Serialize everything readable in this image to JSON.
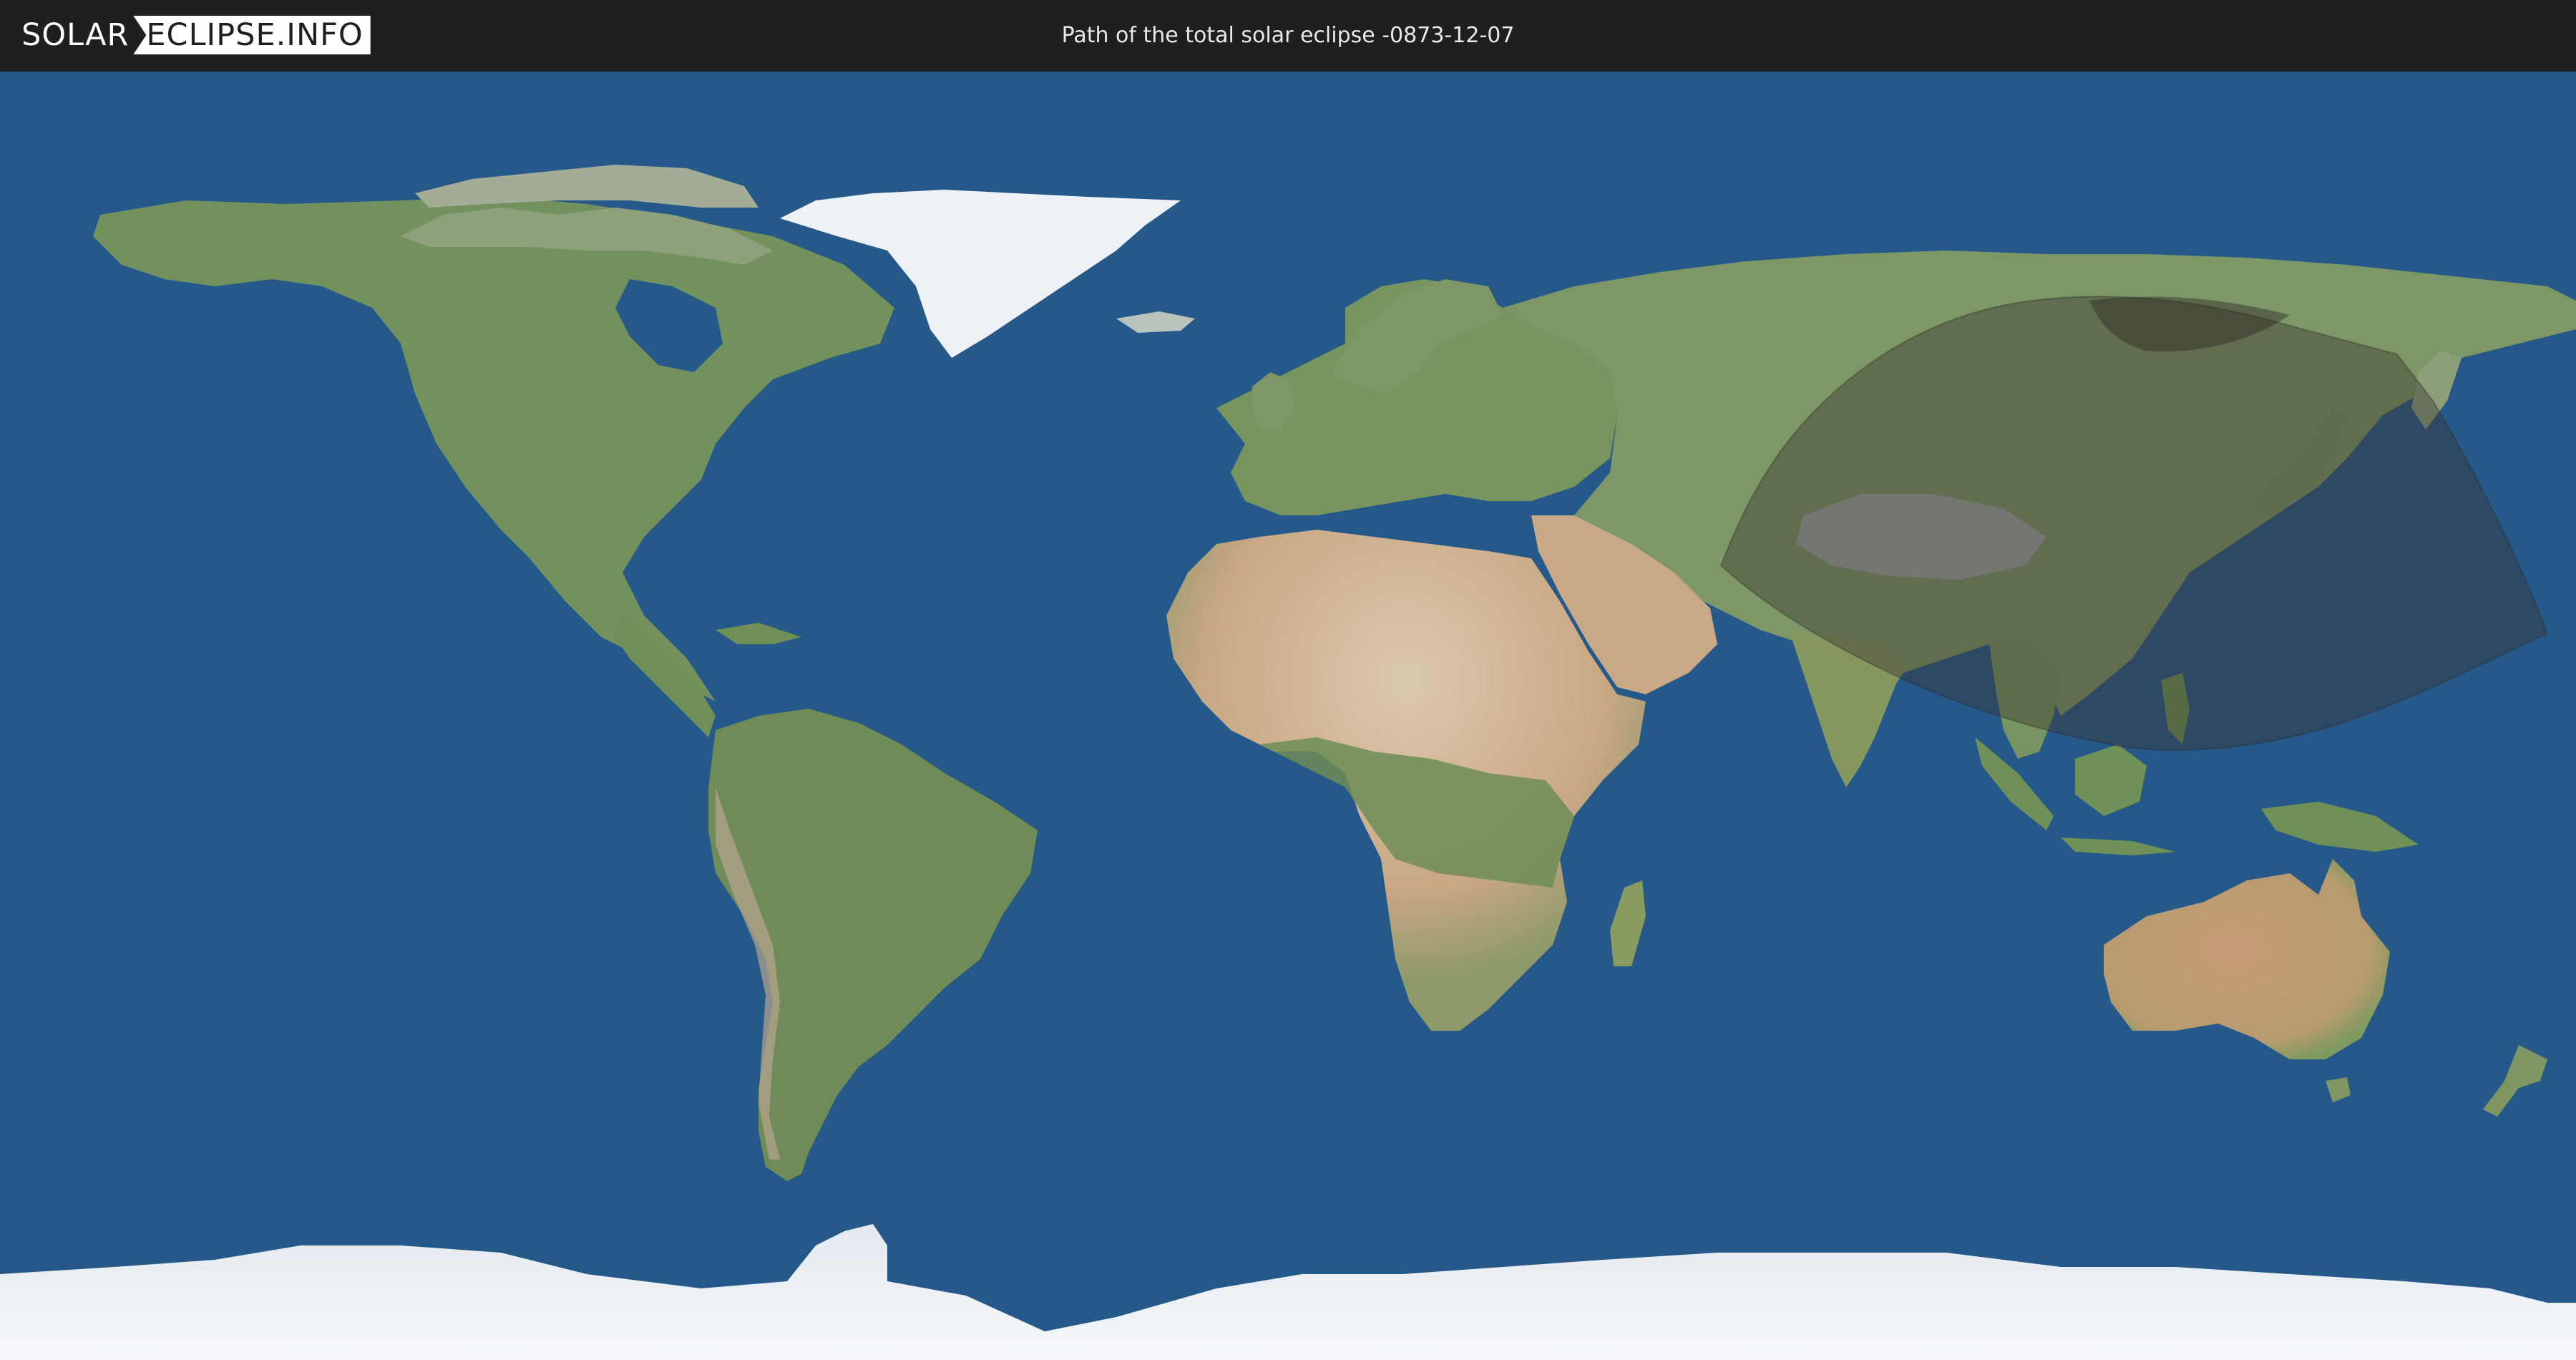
{
  "header": {
    "logo_part1": "SOLAR",
    "logo_part2": "ECLIPSE.INFO",
    "title": "Path of the total solar eclipse -0873-12-07"
  },
  "colors": {
    "header_bg": "#1f1f1f",
    "ocean": "#25598a",
    "land": "#6f8f5a",
    "desert": "#c9a784",
    "ice": "#eef1f5",
    "eclipse_shadow": "#3a3530"
  }
}
